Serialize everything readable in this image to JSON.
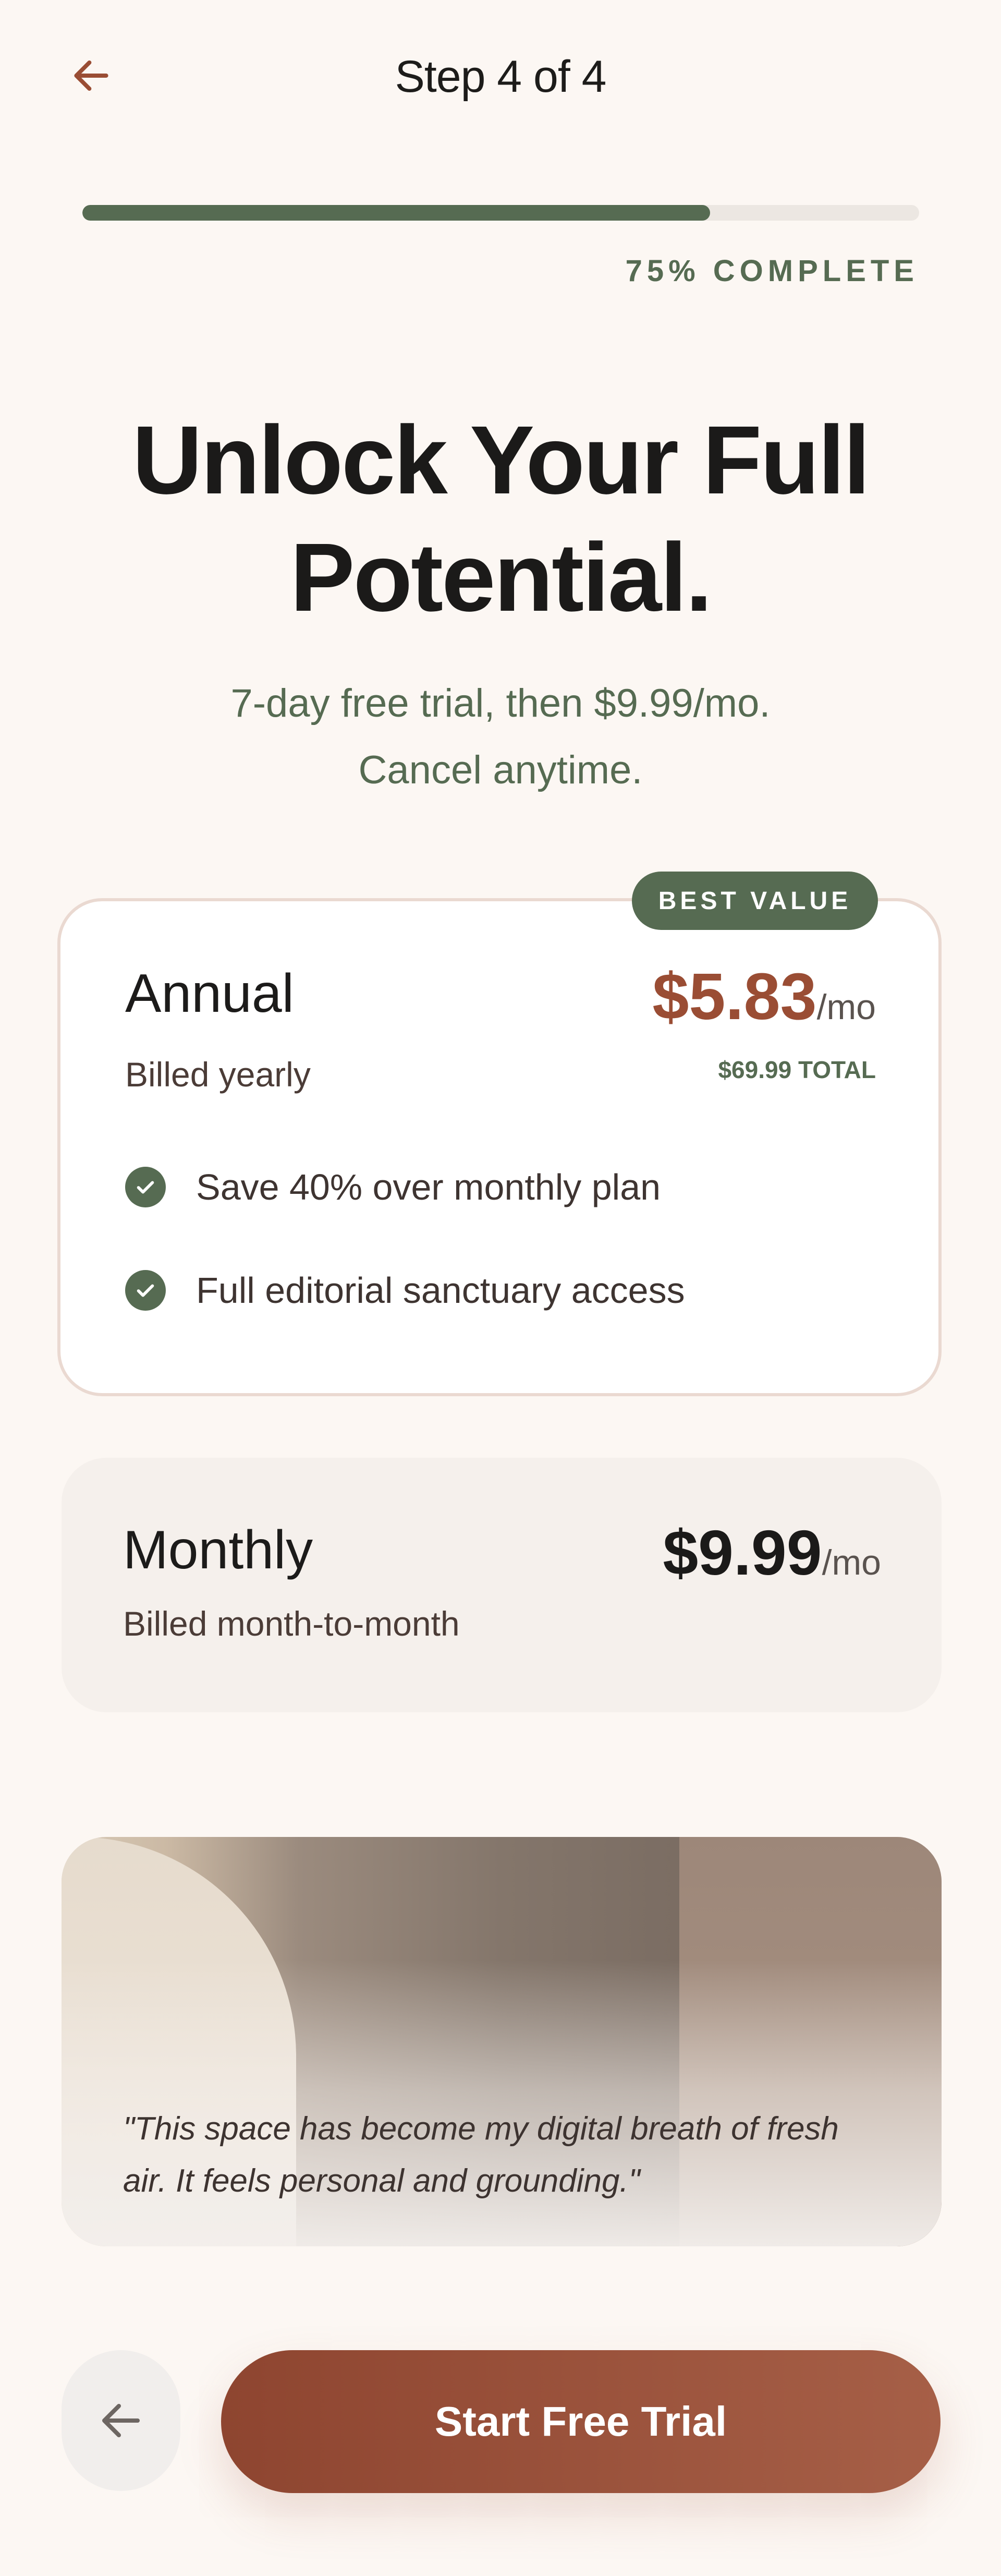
{
  "header": {
    "step_label": "Step 4 of 4",
    "back_icon": "arrow-left-icon"
  },
  "progress": {
    "fraction": 0.75,
    "label": "75% COMPLETE"
  },
  "hero": {
    "title_line1": "Unlock Your Full",
    "title_line2": "Potential.",
    "subtitle_line1": "7-day free trial, then $9.99/mo.",
    "subtitle_line2": "Cancel anytime."
  },
  "plans": {
    "annual": {
      "badge": "BEST VALUE",
      "name": "Annual",
      "billing": "Billed yearly",
      "price": "$5.83",
      "unit": "/mo",
      "total": "$69.99 TOTAL",
      "features": [
        "Save 40% over monthly plan",
        "Full editorial sanctuary access"
      ]
    },
    "monthly": {
      "name": "Monthly",
      "billing": "Billed month-to-month",
      "price": "$9.99",
      "unit": "/mo"
    }
  },
  "testimonial": {
    "quote_line1": "\"This space has become my digital breath of fresh",
    "quote_line2": "air. It feels personal and grounding.\""
  },
  "footer": {
    "cta_label": "Start Free Trial",
    "back_icon": "arrow-left-icon"
  },
  "colors": {
    "accent": "#9a4d34",
    "sage": "#566b52",
    "background": "#fcf7f3"
  }
}
